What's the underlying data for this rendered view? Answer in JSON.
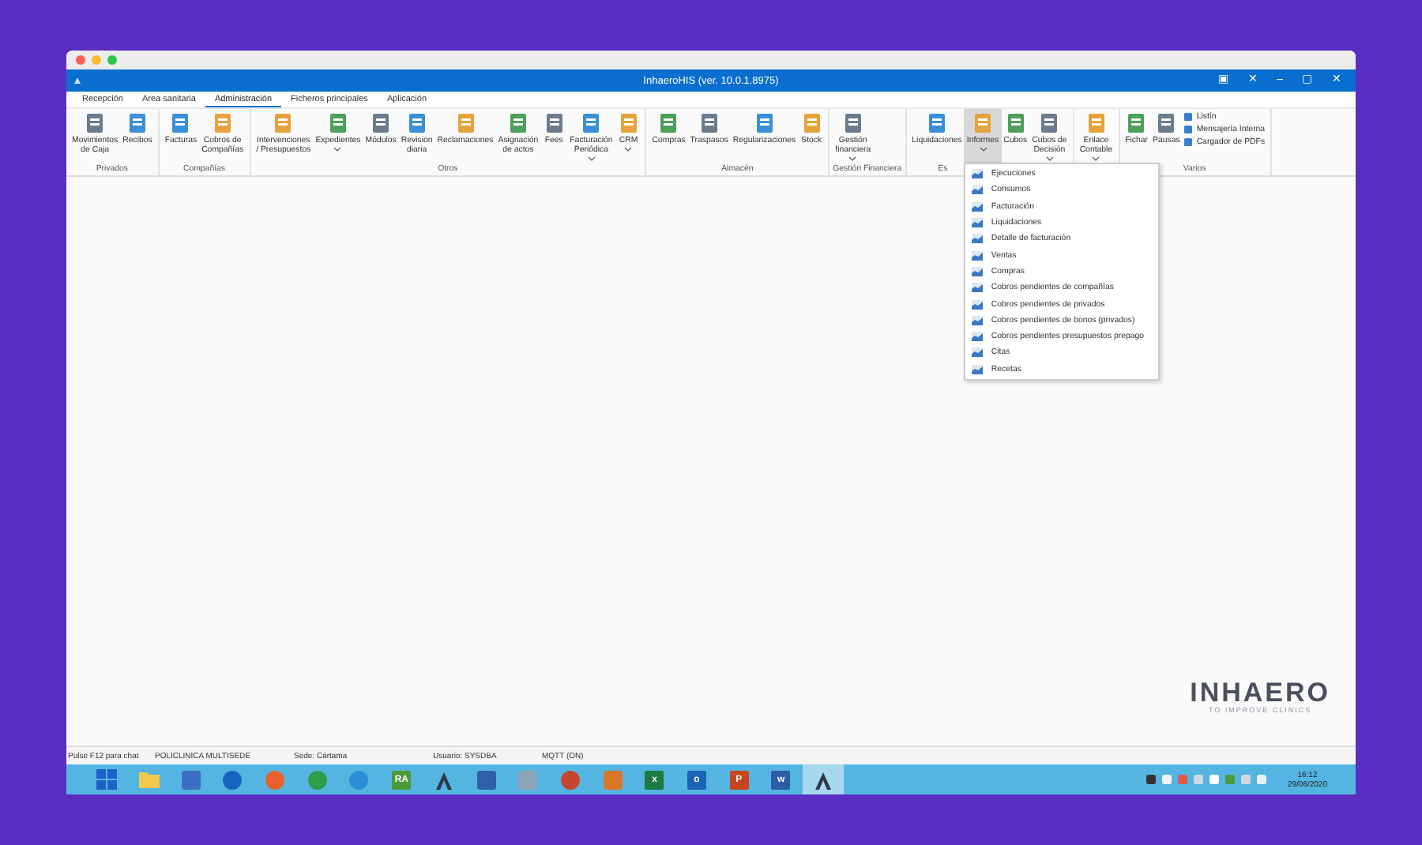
{
  "window": {
    "title": "InhaeroHIS (ver. 10.0.1.8975)",
    "title_buttons": [
      "▣",
      "✕",
      "–",
      "▢",
      "✕"
    ]
  },
  "tabs": [
    {
      "label": "Recepción",
      "selected": false
    },
    {
      "label": "Area sanitaria",
      "selected": false
    },
    {
      "label": "Administración",
      "selected": true
    },
    {
      "label": "Ficheros principales",
      "selected": false
    },
    {
      "label": "Aplicación",
      "selected": false
    }
  ],
  "ribbon_groups": [
    {
      "label": "Privados",
      "items": [
        {
          "kind": "large",
          "label": "Movimientos\nde Caja",
          "menu": false,
          "selected": false
        },
        {
          "kind": "large",
          "label": "Recibos",
          "menu": false,
          "selected": false
        }
      ]
    },
    {
      "label": "Compañías",
      "items": [
        {
          "kind": "large",
          "label": "Facturas",
          "menu": false,
          "selected": false
        },
        {
          "kind": "large",
          "label": "Cobros de\nCompañías",
          "menu": false,
          "selected": false
        }
      ]
    },
    {
      "label": "Otros",
      "items": [
        {
          "kind": "large",
          "label": "Intervenciones\n/ Presupuestos",
          "menu": false,
          "selected": false
        },
        {
          "kind": "large",
          "label": "Expedientes",
          "menu": true,
          "selected": false
        },
        {
          "kind": "large",
          "label": "Módulos",
          "menu": false,
          "selected": false
        },
        {
          "kind": "large",
          "label": "Revision\ndiaria",
          "menu": false,
          "selected": false
        },
        {
          "kind": "large",
          "label": "Reclamaciones",
          "menu": false,
          "selected": false
        },
        {
          "kind": "large",
          "label": "Asignación\nde actos",
          "menu": false,
          "selected": false
        },
        {
          "kind": "large",
          "label": "Fees",
          "menu": false,
          "selected": false
        },
        {
          "kind": "large",
          "label": "Facturación\nPeriódica",
          "menu": true,
          "selected": false
        },
        {
          "kind": "large",
          "label": "CRM",
          "menu": true,
          "selected": false
        }
      ]
    },
    {
      "label": "Almacén",
      "items": [
        {
          "kind": "large",
          "label": "Compras",
          "menu": false,
          "selected": false
        },
        {
          "kind": "large",
          "label": "Traspasos",
          "menu": false,
          "selected": false
        },
        {
          "kind": "large",
          "label": "Regularizaciones",
          "menu": false,
          "selected": false
        },
        {
          "kind": "large",
          "label": "Stock",
          "menu": false,
          "selected": false
        }
      ]
    },
    {
      "label": "Gestión Financiera",
      "items": [
        {
          "kind": "large",
          "label": "Gestión\nfinanciera",
          "menu": true,
          "selected": false
        }
      ]
    },
    {
      "label": "Es",
      "items": [
        {
          "kind": "large",
          "label": "Liquidaciones",
          "menu": false,
          "selected": false
        },
        {
          "kind": "large",
          "label": "Informes",
          "menu": true,
          "selected": true
        },
        {
          "kind": "large",
          "label": "Cubos",
          "menu": false,
          "selected": false
        },
        {
          "kind": "large",
          "label": "Cubos de\nDecisión",
          "menu": true,
          "selected": false
        }
      ]
    },
    {
      "items": [
        {
          "kind": "large",
          "label": "Enlace\nContable",
          "menu": true,
          "selected": false
        }
      ]
    },
    {
      "label": "Varios",
      "items": [
        {
          "kind": "large",
          "label": "Fichar",
          "menu": false,
          "selected": false
        },
        {
          "kind": "large",
          "label": "Pausas",
          "menu": false,
          "selected": false
        },
        {
          "kind": "small",
          "label": "Listín",
          "menu": false,
          "selected": false
        },
        {
          "kind": "small",
          "label": "Mensajería Interna",
          "menu": false,
          "selected": false
        },
        {
          "kind": "small",
          "label": "Cargador de PDFs",
          "menu": false,
          "selected": false
        }
      ]
    }
  ],
  "informes_menu": [
    "Ejecuciones",
    "Consumos",
    "Facturación",
    "Liquidaciones",
    "Detalle de facturación",
    "Ventas",
    "Compras",
    "Cobros pendientes de compañías",
    "Cobros pendientes de privados",
    "Cobros pendientes de bonos (privados)",
    "Cobros pendientes presupuestos prepago",
    "Citas",
    "Recetas"
  ],
  "logo": {
    "name": "INHAERO",
    "tagline": "TO IMPROVE CLINICS"
  },
  "status_bar": [
    "Pulse F12 para chat",
    "POLICLINICA MULTISEDE",
    "Sede: Cártama",
    "Usuario: SYSDBA",
    "MQTT (ON)"
  ],
  "taskbar": {
    "items": [
      {
        "kind": "grid",
        "selected": false
      },
      {
        "kind": "folder",
        "selected": false
      },
      {
        "kind": "square",
        "color": "#3b6fc4",
        "selected": false
      },
      {
        "kind": "circle",
        "color": "#1565c0",
        "selected": false
      },
      {
        "kind": "circle",
        "color": "#e8612c",
        "selected": false
      },
      {
        "kind": "circle",
        "color": "#2e9e49",
        "selected": false
      },
      {
        "kind": "circle",
        "color": "#2a8fd4",
        "selected": false
      },
      {
        "kind": "letters",
        "text": "RA",
        "color": "#4a9a3a",
        "selected": false
      },
      {
        "kind": "peak",
        "selected": false
      },
      {
        "kind": "square",
        "color": "#2f5fa8",
        "selected": false
      },
      {
        "kind": "square",
        "color": "#8aa3b8",
        "selected": false
      },
      {
        "kind": "circle",
        "color": "#c7452f",
        "selected": false
      },
      {
        "kind": "square",
        "color": "#d8772a",
        "selected": false
      },
      {
        "kind": "letters",
        "text": "x",
        "color": "#1e7a43",
        "selected": false
      },
      {
        "kind": "letters",
        "text": "o",
        "color": "#1b63b8",
        "selected": false
      },
      {
        "kind": "letters",
        "text": "P",
        "color": "#c8461f",
        "selected": false
      },
      {
        "kind": "letters",
        "text": "w",
        "color": "#2b5ca8",
        "selected": false
      },
      {
        "kind": "peak",
        "selected": true
      }
    ],
    "time": "16:12",
    "date": "29/06/2020"
  }
}
